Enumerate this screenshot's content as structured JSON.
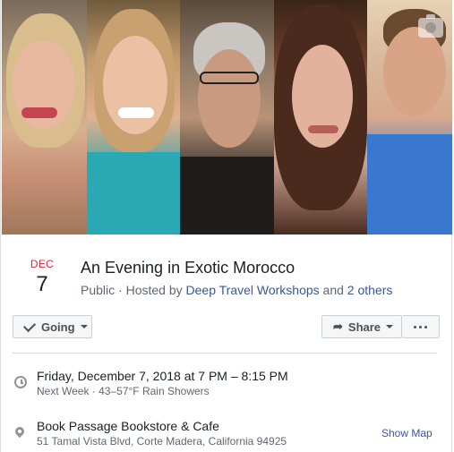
{
  "event": {
    "month": "DEC",
    "day": "7",
    "title": "An Evening in Exotic Morocco",
    "privacy": "Public",
    "hosted_by_prefix": " · Hosted by ",
    "host": "Deep Travel Workshops",
    "and_text": " and ",
    "others": "2 others"
  },
  "actions": {
    "going_label": "Going",
    "share_label": "Share"
  },
  "details": {
    "datetime": "Friday, December 7, 2018 at 7 PM – 8:15 PM",
    "weather": "Next Week · 43–57°F Rain Showers",
    "venue": "Book Passage Bookstore & Cafe",
    "address": "51 Tamal Vista Blvd, Corte Madera, California 94925",
    "show_map": "Show Map"
  },
  "icons": {
    "camera": "camera-icon",
    "check": "check-icon",
    "share": "share-arrow-icon",
    "more": "more-dots-icon",
    "clock": "clock-icon",
    "pin": "map-pin-icon"
  },
  "colors": {
    "accent_link": "#385898",
    "month_red": "#e41e3f"
  }
}
